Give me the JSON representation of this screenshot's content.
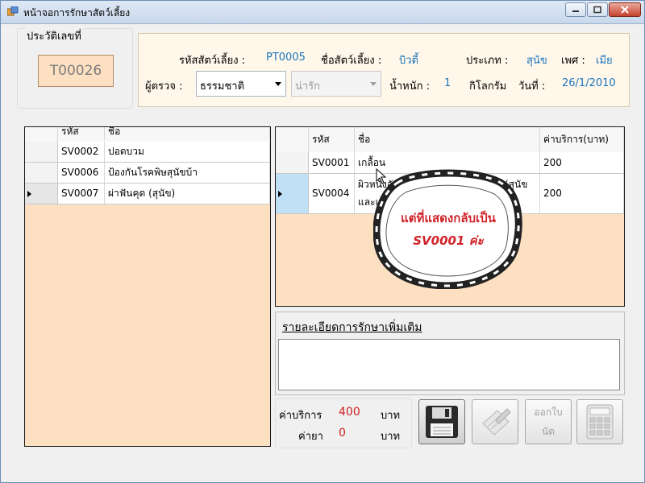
{
  "window": {
    "title": "หน้าจอการรักษาสัตว์เลี้ยง",
    "buttons": [
      "minimize-icon",
      "maximize-icon",
      "close-icon"
    ]
  },
  "history": {
    "label": "ประวัติเลขที่",
    "number": "T00026"
  },
  "pet_info": {
    "pet_id_label": "รหัสสัตว์เลี้ยง :",
    "pet_id": "PT0005",
    "pet_name_label": "ชื่อสัตว์เลี้ยง :",
    "pet_name": "บิวตี้",
    "type_label": "ประเภท :",
    "type": "สุนัข",
    "sex_label": "เพศ :",
    "sex": "เมีย",
    "examiner_label": "ผู้ตรวจ :",
    "examiner": "ธรรมชาติ",
    "second_combo": "น่ารัก",
    "weight_label": "น้ำหนัก :",
    "weight": "1",
    "weight_unit": "กิโลกรัม",
    "date_label": "วันที่ :",
    "date": "26/1/2010"
  },
  "left_grid": {
    "columns": [
      "รหัส",
      "ชื่อ"
    ],
    "rows": [
      {
        "code": "SV0002",
        "name": "ปอดบวม"
      },
      {
        "code": "SV0006",
        "name": "ป้องกันโรคพิษสุนัขบ้า"
      },
      {
        "code": "SV0007",
        "name": "ผ่าฟันคุด (สุนัข)"
      }
    ]
  },
  "right_grid": {
    "columns": [
      "รหัส",
      "ชื่อ",
      "ค่าบริการ(บาท)"
    ],
    "rows": [
      {
        "code": "SV0001",
        "name": "เกลื้อน",
        "name2": "",
        "price": "200"
      },
      {
        "code": "SV0004",
        "name": "ผิวหนังอั",
        "name2": "และแ",
        "name_tail": "(สุนัข",
        "price": "200"
      }
    ]
  },
  "callout": {
    "line1": "แต่ที่แสดงกลับเป็น",
    "line2": "SV0001 ค่ะ"
  },
  "details": {
    "title": "รายละเอียดการรักษาเพิ่มเติม",
    "text": ""
  },
  "costs": {
    "service_label": "ค่าบริการ",
    "service_value": "400",
    "service_unit": "บาท",
    "medicine_label": "ค่ายา",
    "medicine_value": "0",
    "medicine_unit": "บาท"
  },
  "toolbar": {
    "appointment_line1": "ออกใบ",
    "appointment_line2": "นัด"
  },
  "colors": {
    "value_blue": "#1b75bb",
    "cost_red": "#cc1e1e",
    "grid_background": "#fde0c2",
    "panel_background": "#fff7ea"
  }
}
